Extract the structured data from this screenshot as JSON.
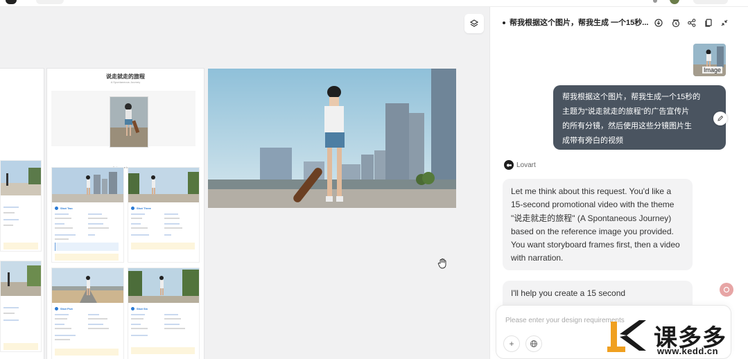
{
  "canvas": {
    "board": {
      "title": "说走就走的旅程",
      "subtitle": "A Spontaneous Journey",
      "cover_caption": "Reference Image"
    },
    "frames": [
      {
        "label": "Shot Two"
      },
      {
        "label": "Shot Three"
      },
      {
        "label": "Shot Five"
      },
      {
        "label": "Shot Six"
      }
    ]
  },
  "panel": {
    "title": "帮我根据这个图片，帮我生成 一个15秒...",
    "thumb_label": "Image",
    "user_message_lines": [
      "帮我根据这个图片，帮我生成一个15秒的",
      "主题为“说走就走的旅程”的广告宣传片",
      "的所有分镜，然后使用这些分镜图片生",
      "成带有旁白的视频"
    ],
    "bot_name": "Lovart",
    "bot_message": "Let me think about this request. You'd like a 15-second promotional video with the theme \"说走就走的旅程\" (A Spontaneous Journey) based on the reference image you provided. You want storyboard frames first, then a video with narration.",
    "bot_message2": "I'll help you create a 15 second",
    "composer_placeholder": "Please enter your design requirements",
    "icons": [
      "download-icon",
      "history-icon",
      "share-icon",
      "copy-icon",
      "collapse-icon",
      "layers-icon",
      "hand-cursor-icon",
      "plus-icon",
      "globe-icon",
      "edit-icon",
      "scroll-down-icon"
    ]
  },
  "watermark": {
    "text": "课多多",
    "url": "www.kedd.cn"
  }
}
